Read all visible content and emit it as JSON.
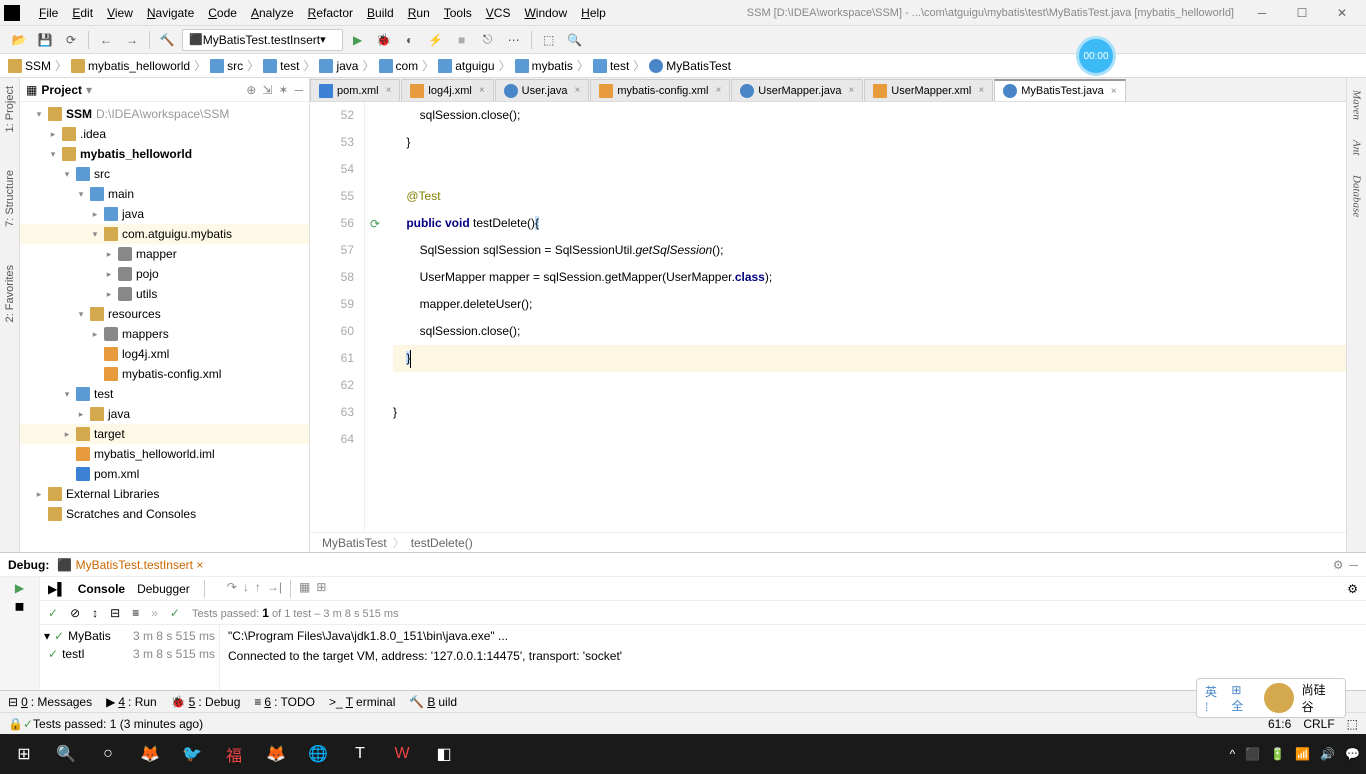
{
  "title": "SSM [D:\\IDEA\\workspace\\SSM] - ...\\com\\atguigu\\mybatis\\test\\MyBatisTest.java [mybatis_helloworld]",
  "menu": [
    "File",
    "Edit",
    "View",
    "Navigate",
    "Code",
    "Analyze",
    "Refactor",
    "Build",
    "Run",
    "Tools",
    "VCS",
    "Window",
    "Help"
  ],
  "runConfig": "MyBatisTest.testInsert",
  "timer": "00:00",
  "breadcrumbs": [
    "SSM",
    "mybatis_helloworld",
    "src",
    "test",
    "java",
    "com",
    "atguigu",
    "mybatis",
    "test",
    "MyBatisTest"
  ],
  "projectTitle": "Project",
  "tree": {
    "root": "SSM",
    "rootPath": "D:\\IDEA\\workspace\\SSM",
    "items": [
      {
        "depth": 1,
        "arrow": "▾",
        "icon": "folder",
        "label": "SSM",
        "suffix": "D:\\IDEA\\workspace\\SSM",
        "bold": true
      },
      {
        "depth": 2,
        "arrow": "▸",
        "icon": "folder",
        "label": ".idea"
      },
      {
        "depth": 2,
        "arrow": "▾",
        "icon": "folder",
        "label": "mybatis_helloworld",
        "bold": true
      },
      {
        "depth": 3,
        "arrow": "▾",
        "icon": "folder blue",
        "label": "src"
      },
      {
        "depth": 4,
        "arrow": "▾",
        "icon": "folder blue",
        "label": "main"
      },
      {
        "depth": 5,
        "arrow": "▸",
        "icon": "folder blue",
        "label": "java"
      },
      {
        "depth": 5,
        "arrow": "▾",
        "icon": "folder",
        "label": "com.atguigu.mybatis",
        "sel": true
      },
      {
        "depth": 6,
        "arrow": "▸",
        "icon": "pkg",
        "label": "mapper"
      },
      {
        "depth": 6,
        "arrow": "▸",
        "icon": "pkg",
        "label": "pojo"
      },
      {
        "depth": 6,
        "arrow": "▸",
        "icon": "pkg",
        "label": "utils"
      },
      {
        "depth": 4,
        "arrow": "▾",
        "icon": "folder",
        "label": "resources"
      },
      {
        "depth": 5,
        "arrow": "▸",
        "icon": "pkg",
        "label": "mappers"
      },
      {
        "depth": 5,
        "arrow": "",
        "icon": "xml",
        "label": "log4j.xml"
      },
      {
        "depth": 5,
        "arrow": "",
        "icon": "xml",
        "label": "mybatis-config.xml"
      },
      {
        "depth": 3,
        "arrow": "▾",
        "icon": "folder blue",
        "label": "test"
      },
      {
        "depth": 4,
        "arrow": "▸",
        "icon": "folder",
        "label": "java"
      },
      {
        "depth": 3,
        "arrow": "▸",
        "icon": "folder",
        "label": "target",
        "sel": true
      },
      {
        "depth": 3,
        "arrow": "",
        "icon": "xml",
        "label": "mybatis_helloworld.iml"
      },
      {
        "depth": 3,
        "arrow": "",
        "icon": "m",
        "label": "pom.xml"
      },
      {
        "depth": 1,
        "arrow": "▸",
        "icon": "folder",
        "label": "External Libraries"
      },
      {
        "depth": 1,
        "arrow": "",
        "icon": "folder",
        "label": "Scratches and Consoles"
      }
    ]
  },
  "tabs": [
    {
      "icon": "m",
      "name": "pom.xml"
    },
    {
      "icon": "xml",
      "name": "log4j.xml"
    },
    {
      "icon": "class",
      "name": "User.java"
    },
    {
      "icon": "xml",
      "name": "mybatis-config.xml"
    },
    {
      "icon": "class",
      "name": "UserMapper.java"
    },
    {
      "icon": "xml",
      "name": "UserMapper.xml"
    },
    {
      "icon": "class",
      "name": "MyBatisTest.java",
      "active": true
    }
  ],
  "code": {
    "start": 52,
    "lines": [
      "        sqlSession.close();",
      "    }",
      "",
      "    @Test",
      "    public void testDelete(){",
      "        SqlSession sqlSession = SqlSessionUtil.getSqlSession();",
      "        UserMapper mapper = sqlSession.getMapper(UserMapper.class);",
      "        mapper.deleteUser();",
      "        sqlSession.close();",
      "    }",
      "",
      "}",
      ""
    ]
  },
  "crumb2": [
    "MyBatisTest",
    "testDelete()"
  ],
  "debug": {
    "title": "Debug:",
    "config": "MyBatisTest.testInsert",
    "tab1": "Console",
    "tab2": "Debugger",
    "passed": "Tests passed: 1 of 1 test – 3 m 8 s 515 ms",
    "treeItems": [
      {
        "name": "MyBatis",
        "time": "3 m 8 s 515 ms"
      },
      {
        "name": "testI",
        "time": "3 m 8 s 515 ms"
      }
    ],
    "console": [
      "\"C:\\Program Files\\Java\\jdk1.8.0_151\\bin\\java.exe\" ...",
      "Connected to the target VM, address: '127.0.0.1:14475', transport: 'socket'"
    ]
  },
  "bottomTabs": [
    "0: Messages",
    "4: Run",
    "5: Debug",
    "6: TODO",
    "Terminal",
    "Build"
  ],
  "status": {
    "msg": "Tests passed: 1 (3 minutes ago)",
    "pos": "61:6",
    "enc": "CRLF"
  },
  "rightTabs": [
    "Maven",
    "Ant",
    "Database"
  ],
  "leftTabs": [
    "1: Project",
    "7: Structure",
    "2: Favorites"
  ],
  "badge": "尚硅谷"
}
